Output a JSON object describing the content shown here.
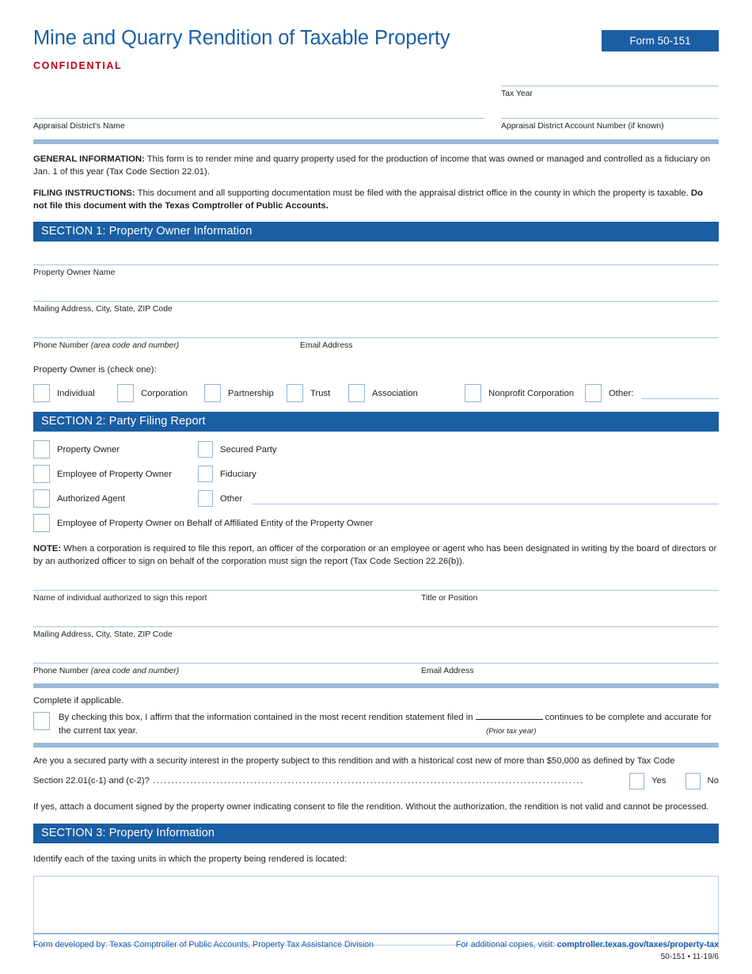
{
  "colors": {
    "brand_blue": "#1a5ea4",
    "title_blue": "#1c5fa5",
    "confidential_red": "#c00014",
    "rule_blue": "#9cb8d8",
    "checkbox_border": "#8fb3d9"
  },
  "header": {
    "title": "Mine and Quarry Rendition of Taxable Property",
    "form_badge": "Form 50-151",
    "confidential": "CONFIDENTIAL"
  },
  "top_fields": {
    "tax_year_label": "Tax Year",
    "tax_year_value": "",
    "appraisal_district_name_label": "Appraisal District's Name",
    "appraisal_district_name_value": "",
    "account_number_label": "Appraisal District Account Number (if known)",
    "account_number_value": ""
  },
  "intro": {
    "general_label": "GENERAL INFORMATION:",
    "general_text": " This form is to render mine and quarry property used for the production of income that was owned or managed and controlled as a fiduciary on Jan. 1 of this year (Tax Code Section 22.01).",
    "filing_label": "FILING INSTRUCTIONS:",
    "filing_text": " This document and all supporting documentation must be filed with the appraisal district office in the county in which the property is taxable. ",
    "filing_bold_tail": "Do not file this document with the Texas Comptroller of Public Accounts."
  },
  "section1": {
    "header": "SECTION 1: Property Owner Information",
    "owner_name_label": "Property Owner Name",
    "owner_name_value": "",
    "mailing_label": "Mailing Address, City, State, ZIP Code",
    "mailing_value": "",
    "phone_label_main": "Phone Number ",
    "phone_label_italic": "(area code and number)",
    "phone_value": "",
    "email_label": "Email Address",
    "email_value": "",
    "owner_is_label": "Property Owner is (check one):",
    "owner_types": [
      "Individual",
      "Corporation",
      "Partnership",
      "Trust",
      "Association",
      "Nonprofit Corporation"
    ],
    "other_label": "Other:",
    "other_value": ""
  },
  "section2": {
    "header": "SECTION 2: Party Filing Report",
    "rows": [
      {
        "left": "Property Owner",
        "right": "Secured Party"
      },
      {
        "left": "Employee of Property Owner",
        "right": "Fiduciary"
      },
      {
        "left": "Authorized Agent",
        "right": "Other"
      }
    ],
    "other_value": "",
    "affiliated_label": "Employee of Property Owner on Behalf of Affiliated Entity of the Property Owner",
    "note_label": "NOTE:",
    "note_text": " When a corporation is required to file this report, an officer of the corporation or an employee or agent who has been designated in writing by the board of directors or by an authorized officer to sign on behalf of the corporation must sign the report (Tax Code Section 22.26(b)).",
    "signer_name_label": "Name of individual authorized to sign this report",
    "signer_name_value": "",
    "title_label": "Title or Position",
    "title_value": "",
    "mailing_label": "Mailing Address, City, State, ZIP Code",
    "mailing_value": "",
    "phone_label_main": "Phone Number ",
    "phone_label_italic": "(area code and number)",
    "phone_value": "",
    "email_label": "Email Address",
    "email_value": "",
    "complete_if_applicable": "Complete if applicable.",
    "affirm_text_part1": "By checking this box, I affirm that the information contained in the most recent rendition statement filed in",
    "affirm_blank_value": "",
    "affirm_text_part2": "continues to be complete and accurate for the current tax year.",
    "prior_tax_year_label": "(Prior tax year)",
    "secured_question_line1": "Are you a secured party with a security interest in the property subject to this rendition and with a historical cost new of more than $50,000 as defined by Tax Code",
    "secured_question_line2": "Section 22.01(c-1) and (c-2)?",
    "yes_label": "Yes",
    "no_label": "No",
    "if_yes_text": "If yes, attach a document signed by the property owner indicating consent to file the rendition. Without the authorization, the rendition is not valid and cannot be processed."
  },
  "section3": {
    "header": "SECTION 3: Property Information",
    "prompt": "Identify each of the taxing units in which the property being rendered is located:",
    "taxing_units_value": ""
  },
  "footer": {
    "left": "Form developed by: Texas Comptroller of Public Accounts, Property Tax Assistance Division",
    "right_prefix": "For additional copies, visit: ",
    "right_link": "comptroller.texas.gov/taxes/property-tax",
    "revision": "50-151 • 11-19/6"
  }
}
